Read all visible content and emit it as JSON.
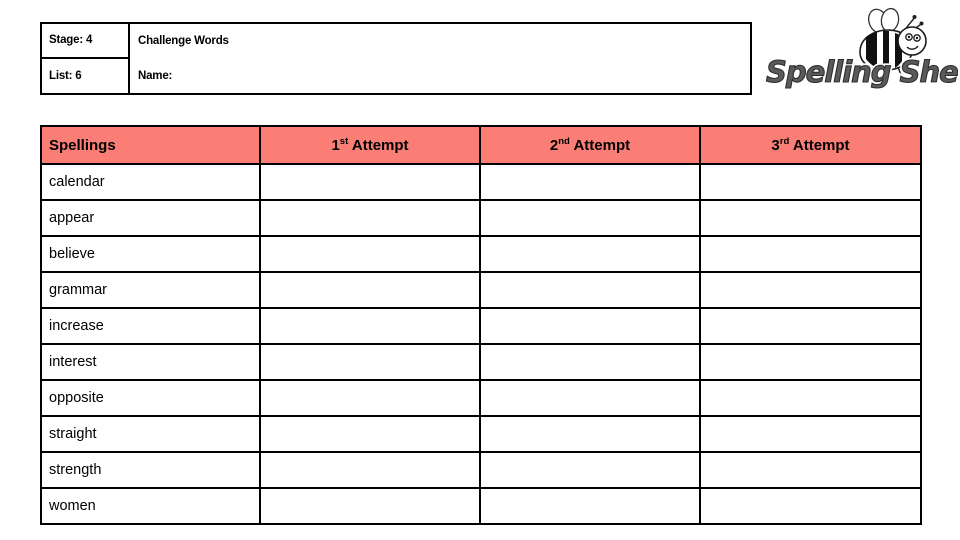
{
  "header": {
    "stage_label": "Stage: 4",
    "list_label": "List: 6",
    "title": "Challenge Words",
    "name_label": "Name:"
  },
  "logo": {
    "wordmark": "Spelling Shed",
    "bee_icon": "bee-icon"
  },
  "table": {
    "columns": [
      {
        "label": "Spellings",
        "ordinal": "",
        "suffix": ""
      },
      {
        "label": "Attempt",
        "ordinal": "1",
        "suffix": "st"
      },
      {
        "label": "Attempt",
        "ordinal": "2",
        "suffix": "nd"
      },
      {
        "label": "Attempt",
        "ordinal": "3",
        "suffix": "rd"
      }
    ],
    "header_color": "#fa7e75",
    "words": [
      "calendar",
      "appear",
      "believe",
      "grammar",
      "increase",
      "interest",
      "opposite",
      "straight",
      "strength",
      "women"
    ]
  }
}
